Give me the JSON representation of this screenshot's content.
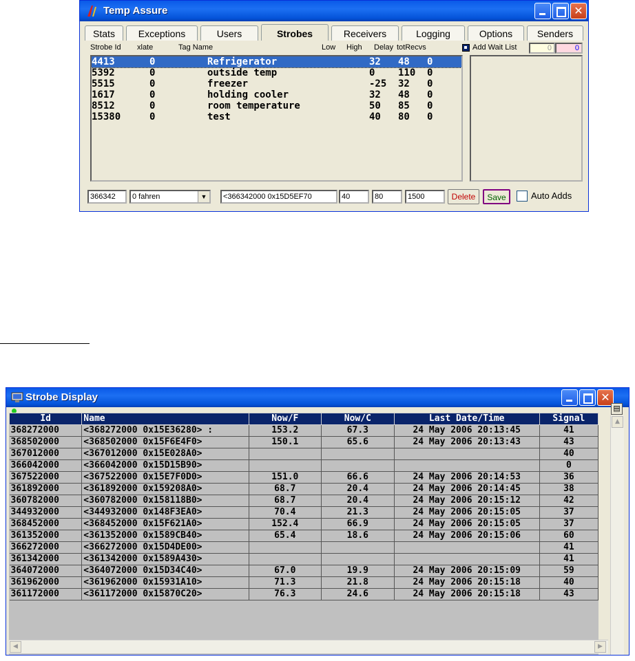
{
  "temp_assure": {
    "title": "Temp Assure",
    "tabs": [
      "Stats",
      "Exceptions",
      "Users",
      "Strobes",
      "Receivers",
      "Logging",
      "Options",
      "Senders"
    ],
    "active_tab": "Strobes",
    "columns": [
      "Strobe Id",
      "xlate",
      "Tag Name",
      "Low",
      "High",
      "Delay",
      "totRecvs"
    ],
    "add_wait_list_label": "Add Wait List",
    "wait_count_1": "0",
    "wait_count_2": "0",
    "strobes": [
      {
        "id": "4413",
        "xlate": "0",
        "tag": "Refrigerator",
        "low": "32",
        "high": "48",
        "recvs": "0"
      },
      {
        "id": "5392",
        "xlate": "0",
        "tag": "outside temp",
        "low": "0",
        "high": "110",
        "recvs": "0"
      },
      {
        "id": "5515",
        "xlate": "0",
        "tag": "freezer",
        "low": "-25",
        "high": "32",
        "recvs": "0"
      },
      {
        "id": "1617",
        "xlate": "0",
        "tag": "holding cooler",
        "low": "32",
        "high": "48",
        "recvs": "0"
      },
      {
        "id": "8512",
        "xlate": "0",
        "tag": "room temperature",
        "low": "50",
        "high": "85",
        "recvs": "0"
      },
      {
        "id": "15380",
        "xlate": "0",
        "tag": "test",
        "low": "40",
        "high": "80",
        "recvs": "0"
      }
    ],
    "edit": {
      "id_value": "366342",
      "xlate_value": "0 fahren",
      "name_value": "<366342000 0x15D5EF70",
      "low_value": "40",
      "high_value": "80",
      "delay_value": "1500"
    },
    "delete_label": "Delete",
    "save_label": "Save",
    "auto_adds_label": "Auto Adds"
  },
  "strobe_display": {
    "title": "Strobe Display",
    "columns": [
      "Id",
      "Name",
      "Now/F",
      "Now/C",
      "Last Date/Time",
      "Signal"
    ],
    "rows": [
      [
        "368272000",
        "<368272000 0x15E36280> :",
        "153.2",
        "67.3",
        "24 May 2006 20:13:45",
        "41"
      ],
      [
        "368502000",
        "<368502000 0x15F6E4F0>",
        "150.1",
        "65.6",
        "24 May 2006 20:13:43",
        "43"
      ],
      [
        "367012000",
        "<367012000 0x15E028A0>",
        "",
        "",
        "",
        "40"
      ],
      [
        "366042000",
        "<366042000 0x15D15B90>",
        "",
        "",
        "",
        "0"
      ],
      [
        "367522000",
        "<367522000 0x15E7F0D0>",
        "151.0",
        "66.6",
        "24 May 2006 20:14:53",
        "36"
      ],
      [
        "361892000",
        "<361892000 0x159208A0>",
        "68.7",
        "20.4",
        "24 May 2006 20:14:45",
        "38"
      ],
      [
        "360782000",
        "<360782000 0x158118B0>",
        "68.7",
        "20.4",
        "24 May 2006 20:15:12",
        "42"
      ],
      [
        "344932000",
        "<344932000 0x148F3EA0>",
        "70.4",
        "21.3",
        "24 May 2006 20:15:05",
        "37"
      ],
      [
        "368452000",
        "<368452000 0x15F621A0>",
        "152.4",
        "66.9",
        "24 May 2006 20:15:05",
        "37"
      ],
      [
        "361352000",
        "<361352000 0x1589CB40>",
        "65.4",
        "18.6",
        "24 May 2006 20:15:06",
        "60"
      ],
      [
        "366272000",
        "<366272000 0x15D4DE00>",
        "",
        "",
        "",
        "41"
      ],
      [
        "361342000",
        "<361342000 0x1589A430>",
        "",
        "",
        "",
        "41"
      ],
      [
        "364072000",
        "<364072000 0x15D34C40>",
        "67.0",
        "19.9",
        "24 May 2006 20:15:09",
        "59"
      ],
      [
        "361962000",
        "<361962000 0x15931A10>",
        "71.3",
        "21.8",
        "24 May 2006 20:15:18",
        "40"
      ],
      [
        "361172000",
        "<361172000 0x15870C20>",
        "76.3",
        "24.6",
        "24 May 2006 20:15:18",
        "43"
      ]
    ]
  }
}
